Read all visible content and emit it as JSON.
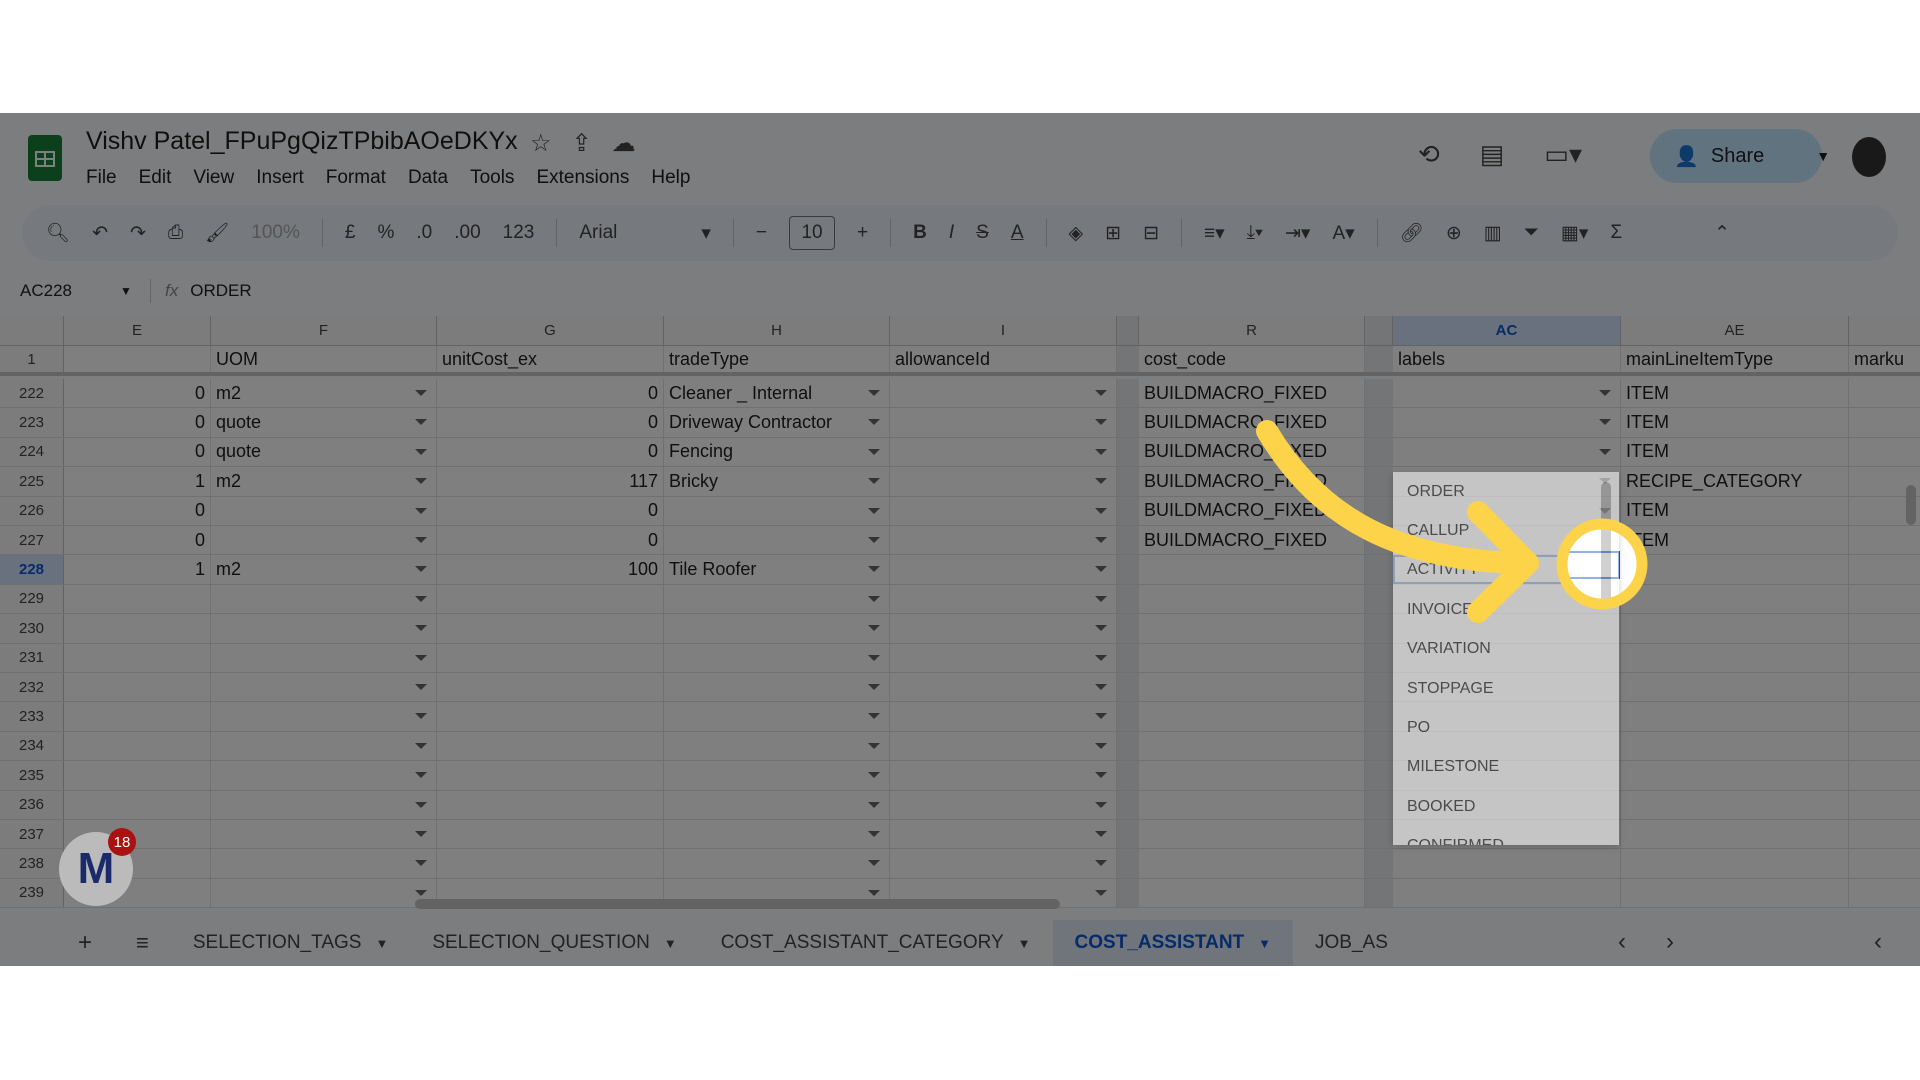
{
  "doc": {
    "title": "Vishv Patel_FPuPgQizTPbibAOeDKYx",
    "menu": [
      "File",
      "Edit",
      "View",
      "Insert",
      "Format",
      "Data",
      "Tools",
      "Extensions",
      "Help"
    ],
    "share_label": "Share"
  },
  "toolbar": {
    "zoom": "100%",
    "currency": "£",
    "percent": "%",
    "dec_minus": ".0",
    "dec_plus": ".00",
    "format_123": "123",
    "font": "Arial",
    "font_size": "10",
    "bold": "B",
    "italic": "I"
  },
  "formula": {
    "cell_ref": "AC228",
    "fx": "fx",
    "value": "ORDER"
  },
  "columns": [
    {
      "id": "E",
      "header": ""
    },
    {
      "id": "F",
      "header": "UOM"
    },
    {
      "id": "G",
      "header": "unitCost_ex"
    },
    {
      "id": "H",
      "header": "tradeType"
    },
    {
      "id": "I",
      "header": "allowanceId"
    },
    {
      "id": "R",
      "header": "cost_code"
    },
    {
      "id": "AC",
      "header": "labels"
    },
    {
      "id": "AE",
      "header": "mainLineItemType"
    },
    {
      "id": "",
      "header": "marku"
    }
  ],
  "rows": [
    {
      "n": "222",
      "E": "0",
      "F": "m2",
      "G": "0",
      "H": "Cleaner _ Internal",
      "I": "",
      "R": "BUILDMACRO_FIXED",
      "AC": "",
      "AE": "ITEM"
    },
    {
      "n": "223",
      "E": "0",
      "F": "quote",
      "G": "0",
      "H": "Driveway Contractor",
      "I": "",
      "R": "BUILDMACRO_FIXED",
      "AC": "",
      "AE": "ITEM"
    },
    {
      "n": "224",
      "E": "0",
      "F": "quote",
      "G": "0",
      "H": "Fencing",
      "I": "",
      "R": "BUILDMACRO_FIXED",
      "AC": "",
      "AE": "ITEM"
    },
    {
      "n": "225",
      "E": "1",
      "F": "m2",
      "G": "117",
      "H": "Bricky",
      "I": "",
      "R": "BUILDMACRO_FIXED",
      "AC": "",
      "AE": "RECIPE_CATEGORY"
    },
    {
      "n": "226",
      "E": "0",
      "F": "",
      "G": "0",
      "H": "",
      "I": "",
      "R": "BUILDMACRO_FIXED",
      "AC": "",
      "AE": "ITEM"
    },
    {
      "n": "227",
      "E": "0",
      "F": "",
      "G": "0",
      "H": "",
      "I": "",
      "R": "BUILDMACRO_FIXED",
      "AC": "",
      "AE": "ITEM"
    },
    {
      "n": "228",
      "E": "1",
      "F": "m2",
      "G": "100",
      "H": "Tile Roofer",
      "I": "",
      "R": "",
      "AC": "",
      "AE": ""
    },
    {
      "n": "229"
    },
    {
      "n": "230"
    },
    {
      "n": "231"
    },
    {
      "n": "232"
    },
    {
      "n": "233"
    },
    {
      "n": "234"
    },
    {
      "n": "235"
    },
    {
      "n": "236"
    },
    {
      "n": "237"
    },
    {
      "n": "238"
    },
    {
      "n": "239"
    }
  ],
  "dropdown_options": [
    "ORDER",
    "CALLUP",
    "ACTIVITY",
    "INVOICE",
    "VARIATION",
    "STOPPAGE",
    "PO",
    "MILESTONE",
    "BOOKED",
    "CONFIRMED"
  ],
  "sheets": [
    {
      "label": "SELECTION_TAGS"
    },
    {
      "label": "SELECTION_QUESTION"
    },
    {
      "label": "COST_ASSISTANT_CATEGORY"
    },
    {
      "label": "COST_ASSISTANT",
      "active": true
    },
    {
      "label": "JOB_AS"
    }
  ],
  "badge": {
    "count": "18"
  },
  "colors": {
    "accent": "#0b57d0",
    "annotation": "#fdd34a",
    "sheets_green": "#188038"
  }
}
